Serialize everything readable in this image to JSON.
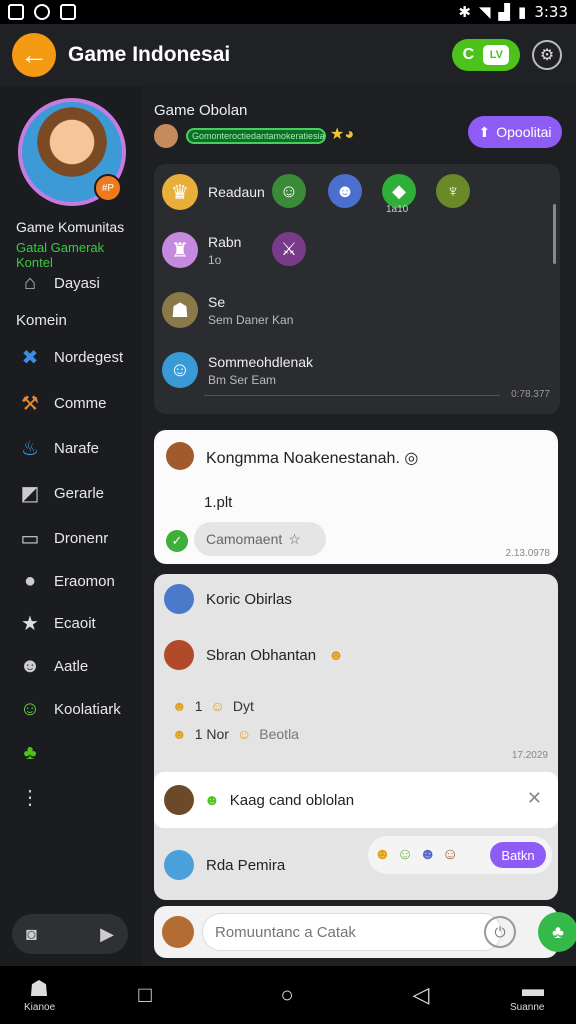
{
  "status_bar": {
    "time": "3:33"
  },
  "app_bar": {
    "title": "Game Indonesai",
    "call_label": "C",
    "cam_label": "LV"
  },
  "sidebar": {
    "community_name": "Game Komunitas",
    "community_sub": "Gatal Gamerak Kontel",
    "avatar_badge": "#P",
    "section_label": "Komein",
    "items": [
      {
        "label": "Dayasi",
        "icon": "home-icon"
      },
      {
        "label": "Nordegest",
        "icon": "handshake-icon"
      },
      {
        "label": "Comme",
        "icon": "hammer-icon"
      },
      {
        "label": "Narafe",
        "icon": "fire-icon"
      },
      {
        "label": "Gerarle",
        "icon": "chart-icon"
      },
      {
        "label": "Dronenr",
        "icon": "folder-icon"
      },
      {
        "label": "Eraomon",
        "icon": "chat-bubble-icon"
      },
      {
        "label": "Ecaoit",
        "icon": "star-icon"
      },
      {
        "label": "Aatle",
        "icon": "robot-icon"
      },
      {
        "label": "Koolatiark",
        "icon": "frog-icon"
      }
    ]
  },
  "main": {
    "conversation": {
      "title": "Game Obolan",
      "progress_text": "Gomonteroctiedantamokeratiesia",
      "open_button": "Opoolitai"
    },
    "game_card": {
      "row1_title": "Readaun",
      "row2_title": "Rabn",
      "row2_sub": "1o",
      "row3_title": "Se",
      "row3_sub": "Sem Daner Kan",
      "row4_title": "Sommeohdlenak",
      "row4_sub": "Bm Ser Eam",
      "caption": "1a10",
      "stamp": "0:78.377"
    },
    "message": {
      "title": "Kongmma Noakenestanah. ◎",
      "line": "1.plt",
      "comment_label": "Camomaent",
      "time": "2.13.0978"
    },
    "thread": {
      "row1": "Koric Obirlas",
      "row2": "Sbran Obhantan",
      "reacts1_a": "1",
      "reacts1_b": "Dyt",
      "reacts2_a": "1 Nor",
      "reacts2_b": "Beotla",
      "time": "17.2029",
      "draft": "Kaag cand oblolan",
      "reply": "Rda Pemira",
      "mini_button": "Batkn"
    },
    "compose": {
      "placeholder": "Romuuntanc a Catak"
    }
  },
  "nav_bar": {
    "left_caption": "Kianoe",
    "right_caption": "Suanne"
  }
}
